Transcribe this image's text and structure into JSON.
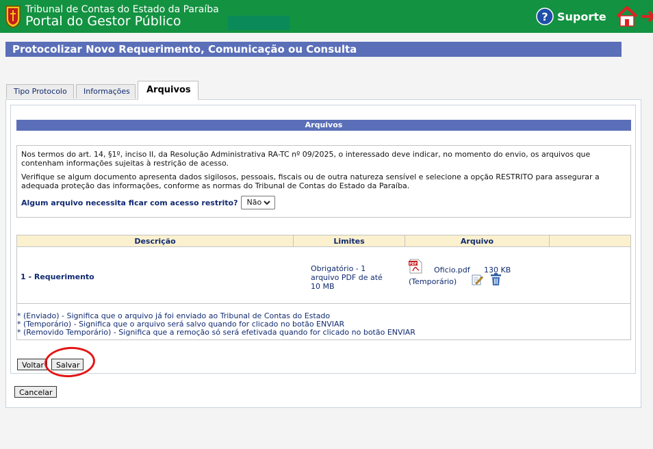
{
  "header": {
    "org_name": "Tribunal de Contas do Estado da Paraíba",
    "portal_name": "Portal do Gestor Público",
    "support_label": "Suporte",
    "colors": {
      "header_bg": "#139241",
      "env_box": "#0a8a58"
    },
    "icons": {
      "crest": "crest-icon",
      "support": "help-icon",
      "home": "home-icon",
      "exit": "exit-icon"
    }
  },
  "page": {
    "title": "Protocolizar Novo Requerimento, Comunicação ou Consulta",
    "accent": "#5a6fb8"
  },
  "tabs": [
    {
      "label": "Tipo Protocolo",
      "active": false
    },
    {
      "label": "Informações",
      "active": false
    },
    {
      "label": "Arquivos",
      "active": true
    }
  ],
  "section": {
    "title": "Arquivos",
    "notice_p1": "Nos termos do art. 14, §1º, inciso II, da Resolução Administrativa RA-TC nº 09/2025, o interessado deve indicar, no momento do envio, os arquivos que contenham informações sujeitas à restrição de acesso.",
    "notice_p2": "Verifique se algum documento apresenta dados sigilosos, pessoais, fiscais ou de outra natureza sensível e selecione a opção RESTRITO para assegurar a adequada proteção das informações, conforme as normas do Tribunal de Contas do Estado da Paraíba.",
    "restricted_question": "Algum arquivo necessita ficar com acesso restrito?",
    "restricted_value": "Não"
  },
  "table": {
    "headers": [
      "Descrição",
      "Limites",
      "Arquivo",
      ""
    ],
    "rows": [
      {
        "description": "1 - Requerimento",
        "limits": "Obrigatório - 1 arquivo PDF de até 10 MB",
        "file_name": "Oficio.pdf",
        "file_size": "130 KB",
        "file_status": "(Temporário)",
        "icons": {
          "file": "pdf-icon",
          "edit": "edit-icon",
          "delete": "trash-icon"
        }
      }
    ],
    "legend": [
      "* (Enviado) - Significa que o arquivo já foi enviado ao Tribunal de Contas do Estado",
      "* (Temporário) - Significa que o arquivo será salvo quando for clicado no botão ENVIAR",
      "* (Removido Temporário) - Significa que a remoção só será efetivada quando for clicado no botão ENVIAR"
    ]
  },
  "buttons": {
    "back": "Voltar",
    "save": "Salvar",
    "cancel": "Cancelar"
  }
}
